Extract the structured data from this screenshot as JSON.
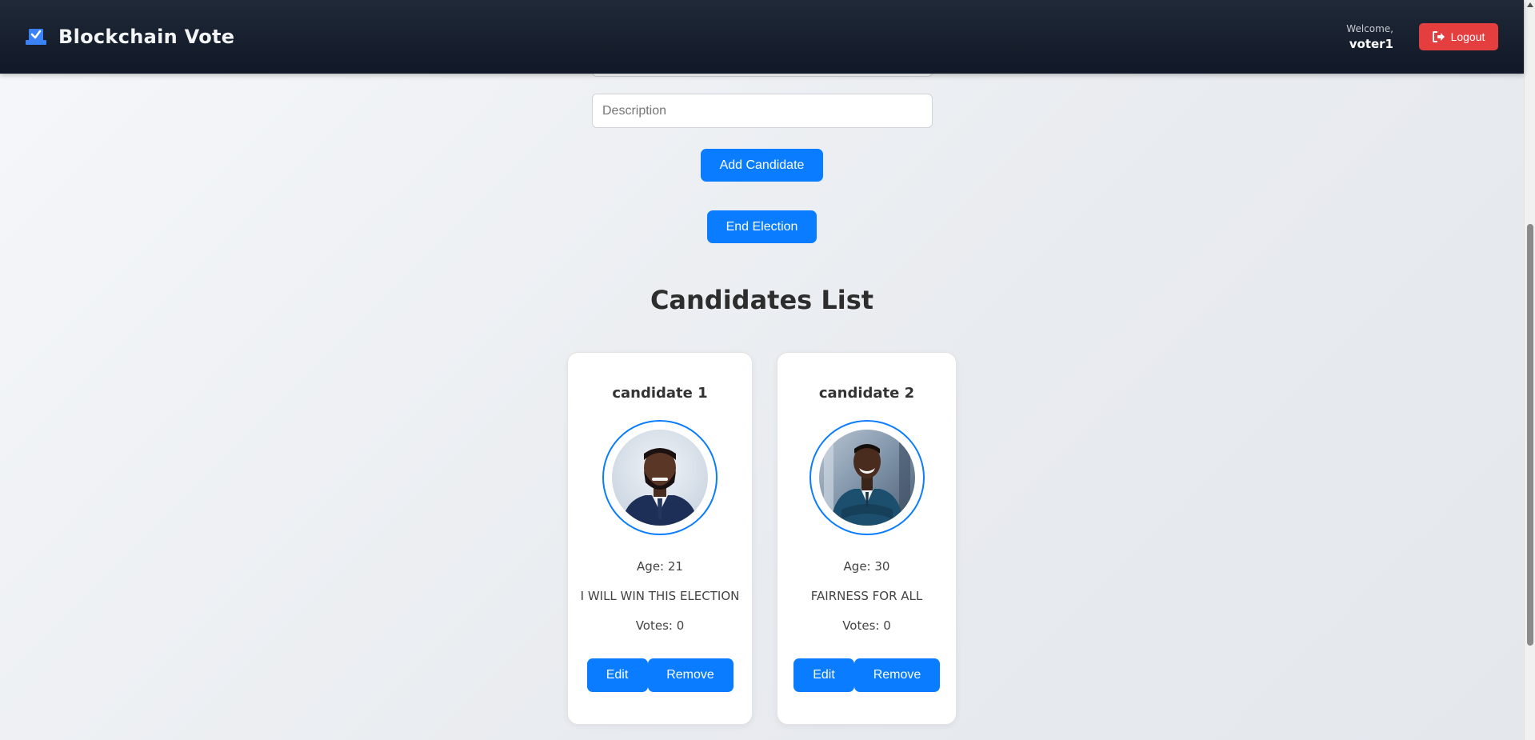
{
  "header": {
    "brand_title": "Blockchain Vote",
    "brand_icon": "ballot-box-icon",
    "welcome_label": "Welcome,",
    "username": "voter1",
    "logout_label": "Logout",
    "logout_icon": "sign-out-icon"
  },
  "form": {
    "description_placeholder": "Description",
    "add_candidate_label": "Add Candidate",
    "end_election_label": "End Election"
  },
  "candidates_section": {
    "title": "Candidates List",
    "candidates": [
      {
        "name": "candidate 1",
        "age_text": "Age: 21",
        "slogan": "I WILL WIN THIS ELECTION",
        "votes_text": "Votes: 0",
        "edit_label": "Edit",
        "remove_label": "Remove"
      },
      {
        "name": "candidate 2",
        "age_text": "Age: 30",
        "slogan": "FAIRNESS FOR ALL",
        "votes_text": "Votes: 0",
        "edit_label": "Edit",
        "remove_label": "Remove"
      }
    ]
  },
  "colors": {
    "header_bg": "#111827",
    "primary": "#0a7cff",
    "danger": "#e53e3e"
  }
}
